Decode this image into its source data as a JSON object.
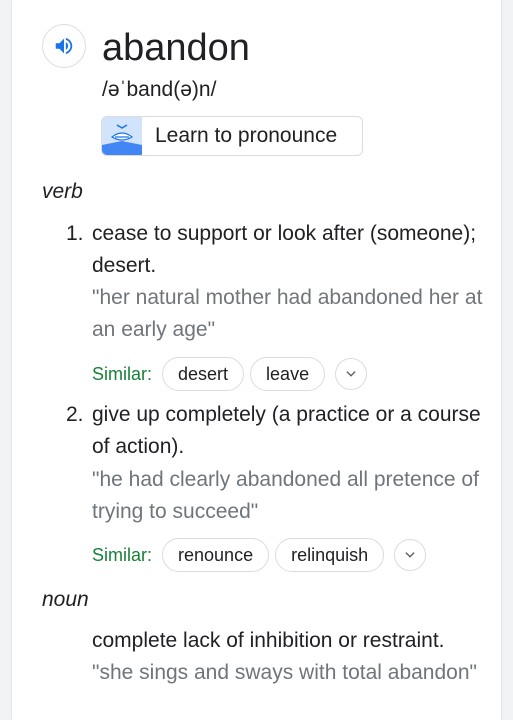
{
  "entry": {
    "word": "abandon",
    "phonetic": "/əˈband(ə)n/",
    "audio_icon": "speaker-icon",
    "learn_button_label": "Learn to pronounce"
  },
  "senses": [
    {
      "pos": "verb",
      "number": "1.",
      "definition": "cease to support or look after (someone); desert.",
      "example": "\"her natural mother had abandoned her at an early age\"",
      "similar_label": "Similar:",
      "similar": [
        "desert",
        "leave"
      ]
    },
    {
      "number": "2.",
      "definition": "give up completely (a practice or a course of action).",
      "example": "\"he had clearly abandoned all pretence of trying to succeed\"",
      "similar_label": "Similar:",
      "similar": [
        "renounce",
        "relinquish"
      ]
    }
  ],
  "noun": {
    "pos": "noun",
    "definition": "complete lack of inhibition or restraint.",
    "example": "\"she sings and sways with total abandon\""
  },
  "colors": {
    "accent_blue": "#1a73e8",
    "similar_green": "#188038",
    "example_gray": "#70757a"
  }
}
